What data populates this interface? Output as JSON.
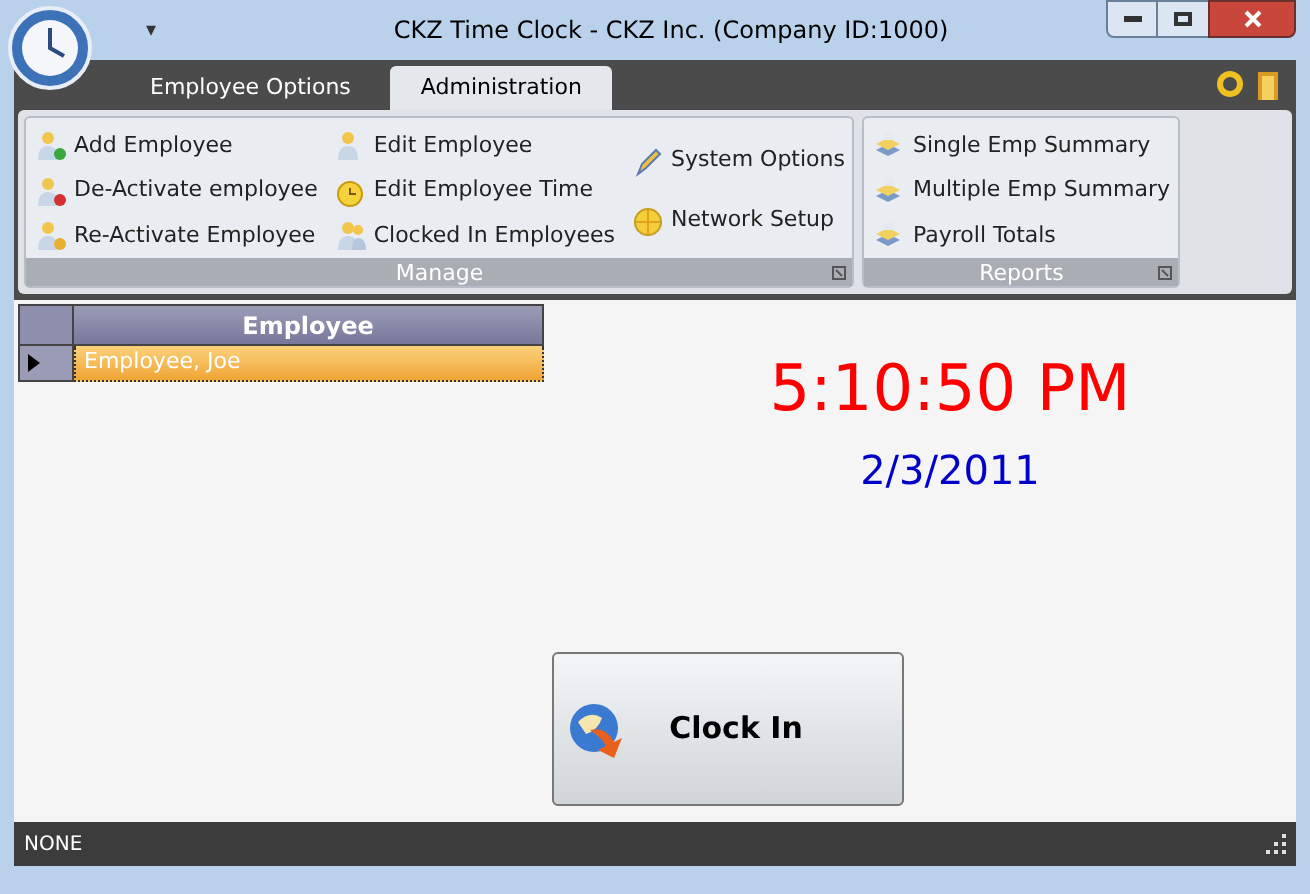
{
  "window": {
    "title": "CKZ Time Clock - CKZ Inc. (Company ID:1000)",
    "quick_access": "▾"
  },
  "tabs": [
    {
      "label": "Employee Options",
      "selected": false
    },
    {
      "label": "Administration",
      "selected": true
    }
  ],
  "ribbon_groups": [
    {
      "label": "Manage",
      "columns": [
        [
          {
            "label": "Add Employee",
            "kind": "person-add"
          },
          {
            "label": "De-Activate employee",
            "kind": "person-remove"
          },
          {
            "label": "Re-Activate Employee",
            "kind": "person-refresh"
          }
        ],
        [
          {
            "label": "Edit Employee",
            "kind": "person"
          },
          {
            "label": "Edit Employee Time",
            "kind": "alarm"
          },
          {
            "label": "Clocked In Employees",
            "kind": "people"
          }
        ],
        [
          {
            "label": "System Options",
            "kind": "pencil"
          },
          {
            "label": "Network Setup",
            "kind": "globe"
          }
        ]
      ]
    },
    {
      "label": "Reports",
      "columns": [
        [
          {
            "label": "Single Emp Summary",
            "kind": "stack"
          },
          {
            "label": "Multiple Emp Summary",
            "kind": "stack"
          },
          {
            "label": "Payroll Totals",
            "kind": "stack"
          }
        ]
      ]
    }
  ],
  "table": {
    "columns": [
      "Employee"
    ],
    "rows": [
      {
        "cells": [
          "Employee, Joe"
        ],
        "selected": true
      }
    ]
  },
  "clock": {
    "time": "5:10:50 PM",
    "date": "2/3/2011"
  },
  "clock_in_button": {
    "label": "Clock In"
  },
  "status_bar": {
    "text": "NONE"
  }
}
